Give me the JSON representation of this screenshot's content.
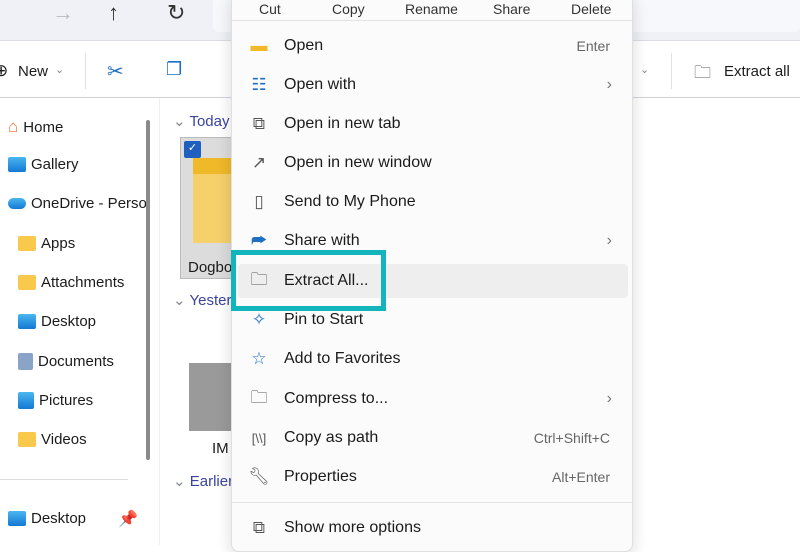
{
  "nav": {
    "back": "←",
    "forward": "→",
    "up": "↑",
    "refresh": "↻"
  },
  "toolbar": {
    "new_label": "New",
    "extract_all": "Extract all"
  },
  "sidebar": {
    "items": [
      {
        "label": "Home"
      },
      {
        "label": "Gallery"
      },
      {
        "label": "OneDrive - Perso"
      },
      {
        "label": "Apps"
      },
      {
        "label": "Attachments"
      },
      {
        "label": "Desktop"
      },
      {
        "label": "Documents"
      },
      {
        "label": "Pictures"
      },
      {
        "label": "Videos"
      }
    ],
    "pinned": {
      "label": "Desktop"
    }
  },
  "content": {
    "groups": [
      {
        "label": "Today"
      },
      {
        "label": "Yestere"
      },
      {
        "label": "Earlier"
      }
    ],
    "files": [
      {
        "name": "Dogbo"
      },
      {
        "name": "IM"
      }
    ]
  },
  "menu": {
    "quick_actions": [
      "Cut",
      "Copy",
      "Rename",
      "Share",
      "Delete"
    ],
    "items": [
      {
        "label": "Open",
        "shortcut": "Enter"
      },
      {
        "label": "Open with"
      },
      {
        "label": "Open in new tab"
      },
      {
        "label": "Open in new window"
      },
      {
        "label": "Send to My Phone"
      },
      {
        "label": "Share with"
      },
      {
        "label": "Extract All..."
      },
      {
        "label": "Pin to Start"
      },
      {
        "label": "Add to Favorites"
      },
      {
        "label": "Compress to..."
      },
      {
        "label": "Copy as path",
        "shortcut": "Ctrl+Shift+C"
      },
      {
        "label": "Properties",
        "shortcut": "Alt+Enter"
      },
      {
        "label": "Show more options"
      }
    ]
  },
  "colors": {
    "highlight": "#13b5bd",
    "accent": "#1f6fc4"
  }
}
